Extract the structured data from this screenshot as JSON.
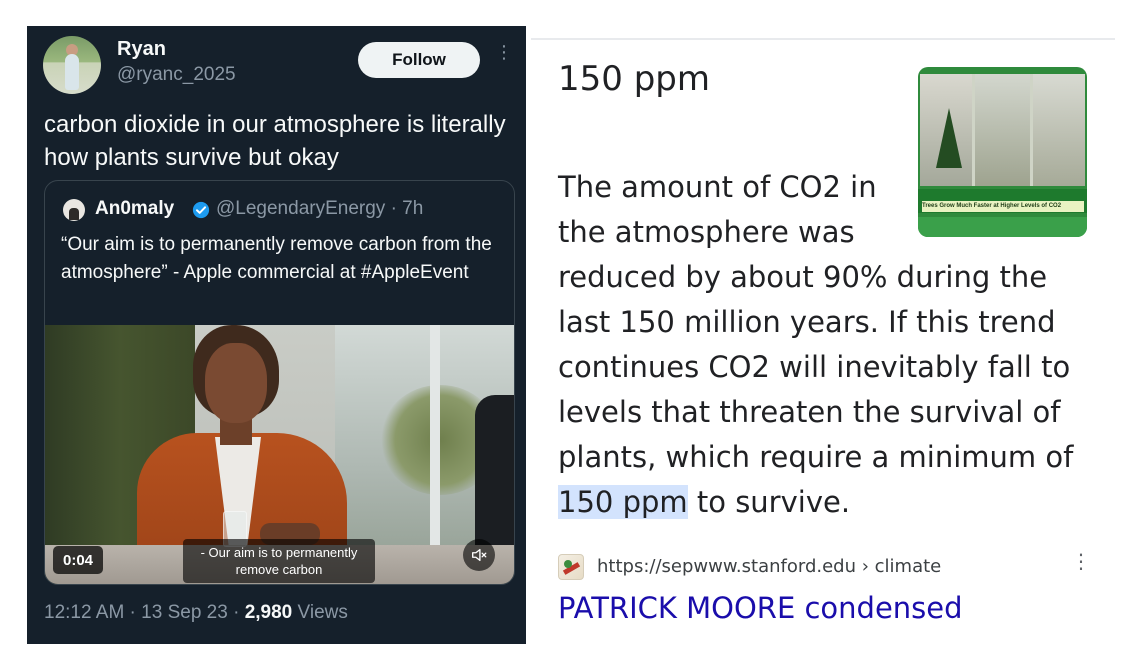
{
  "tweet": {
    "user_name": "Ryan",
    "user_handle": "@ryanc_2025",
    "follow_label": "Follow",
    "more_icon": "⋮",
    "text": "carbon dioxide in our atmosphere is literally how plants survive but okay",
    "quote": {
      "name": "An0maly",
      "meta": "@LegendaryEnergy · 7h",
      "text": "“Our aim is to permanently remove carbon from the atmosphere” - Apple commercial at #AppleEvent",
      "video": {
        "time": "0:04",
        "caption": "- Our aim is to permanently remove carbon"
      }
    },
    "footer": {
      "time_date": "12:12 AM · 13 Sep 23 · ",
      "views_count": "2,980",
      "views_label": " Views"
    }
  },
  "snippet": {
    "title": "150 ppm",
    "image_caption": "Trees Grow Much Faster at Higher Levels of CO2",
    "body_before": "The amount of CO2 in the atmosphere was reduced by about 90% during the last 150 million years. If this trend continues CO2 will inevitably fall to levels that threaten the survival of plants, which require a minimum of ",
    "body_highlight": "150 ppm",
    "body_after": " to survive.",
    "source_url": "https://sepwww.stanford.edu › climate",
    "more_icon": "⋮",
    "result_title": "PATRICK MOORE condensed"
  },
  "colors": {
    "tweet_bg": "#15202b",
    "verified_blue": "#1d9bf0",
    "link_blue": "#1a0dab",
    "highlight": "#d3e3fd"
  }
}
